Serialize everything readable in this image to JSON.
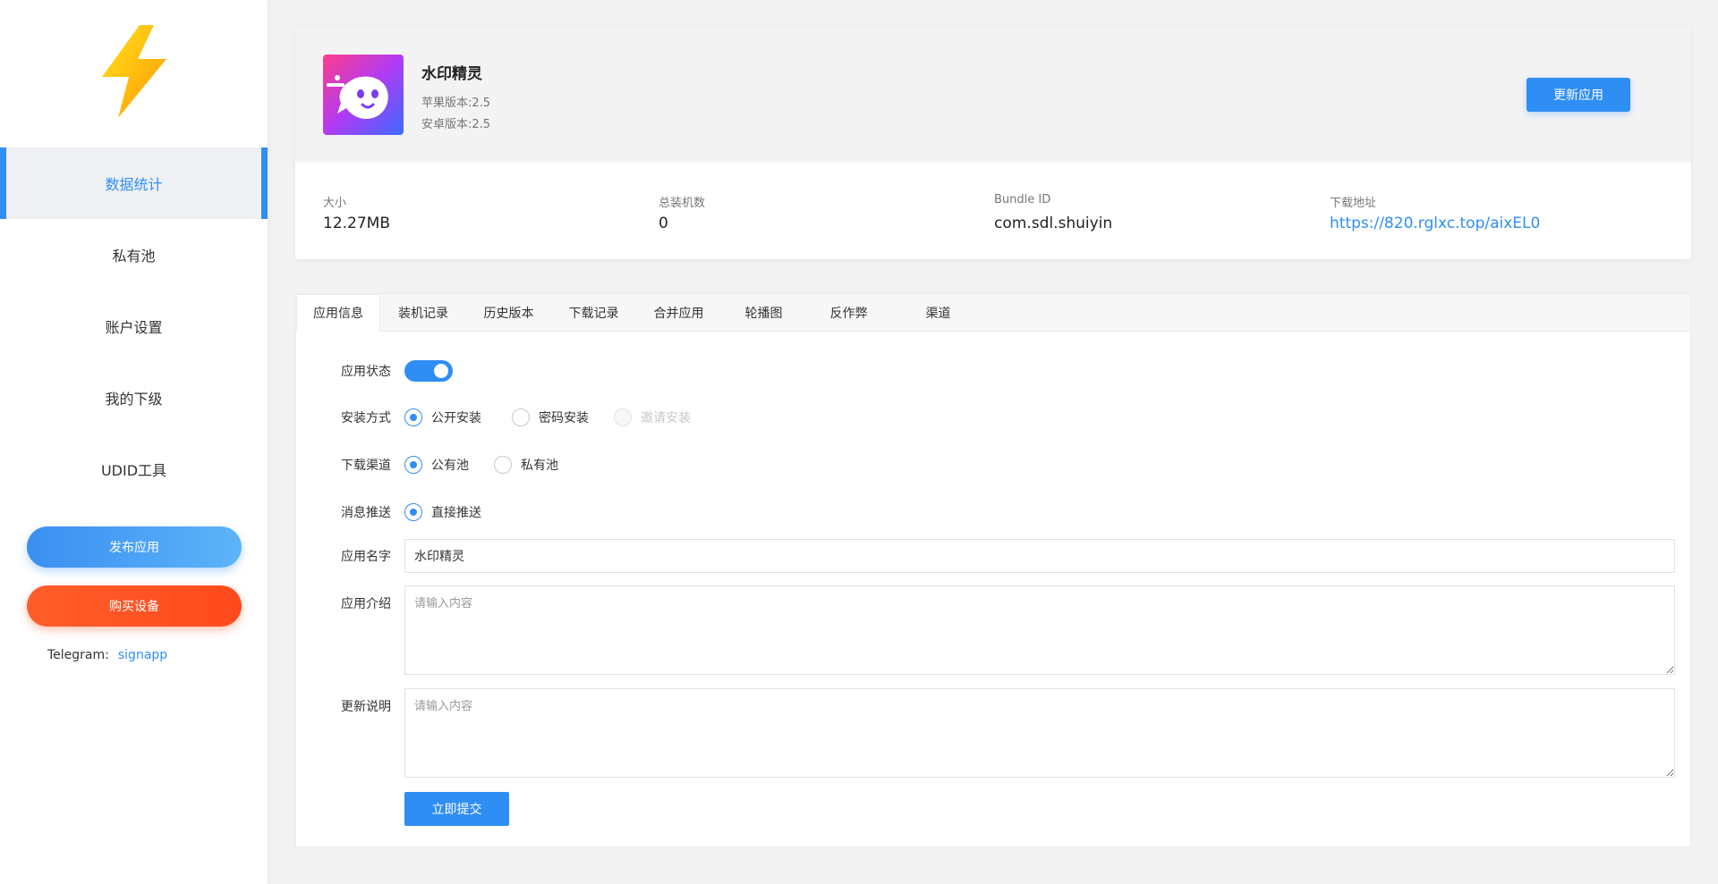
{
  "sidebar": {
    "nav": [
      {
        "label": "数据统计",
        "active": true
      },
      {
        "label": "私有池",
        "active": false
      },
      {
        "label": "账户设置",
        "active": false
      },
      {
        "label": "我的下级",
        "active": false
      },
      {
        "label": "UDID工具",
        "active": false
      }
    ],
    "publish_label": "发布应用",
    "buy_label": "购买设备",
    "telegram_label": "Telegram:",
    "telegram_value": "signapp",
    "logo_icon": "lightning-bolt-icon",
    "colors": {
      "accent": "#2f8ef4",
      "buy": "#ff5224",
      "logo_start": "#ffd21a",
      "logo_end": "#ff9f00"
    }
  },
  "app": {
    "icon": "app-logo-icon",
    "name": "水印精灵",
    "ios_version": "苹果版本:2.5",
    "android_version": "安卓版本:2.5",
    "update_label": "更新应用",
    "stats": [
      {
        "label": "大小",
        "value": "12.27MB",
        "link": false
      },
      {
        "label": "总装机数",
        "value": "0",
        "link": false
      },
      {
        "label": "Bundle ID",
        "value": "com.sdl.shuiyin",
        "link": false
      },
      {
        "label": "下载地址",
        "value": "https://820.rglxc.top/aixEL0",
        "link": true
      }
    ]
  },
  "tabs": [
    {
      "label": "应用信息",
      "active": true
    },
    {
      "label": "装机记录",
      "active": false
    },
    {
      "label": "历史版本",
      "active": false
    },
    {
      "label": "下载记录",
      "active": false
    },
    {
      "label": "合并应用",
      "active": false
    },
    {
      "label": "轮播图",
      "active": false
    },
    {
      "label": "反作弊",
      "active": false
    },
    {
      "label": "渠道",
      "active": false
    }
  ],
  "form": {
    "status": {
      "label": "应用状态",
      "on": true
    },
    "install": {
      "label": "安装方式",
      "options": [
        {
          "label": "公开安装",
          "checked": true,
          "disabled": false
        },
        {
          "label": "密码安装",
          "checked": false,
          "disabled": false
        },
        {
          "label": "邀请安装",
          "checked": false,
          "disabled": true
        }
      ]
    },
    "channel": {
      "label": "下载渠道",
      "options": [
        {
          "label": "公有池",
          "checked": true,
          "disabled": false
        },
        {
          "label": "私有池",
          "checked": false,
          "disabled": false
        }
      ]
    },
    "push": {
      "label": "消息推送",
      "options": [
        {
          "label": "直接推送",
          "checked": true,
          "disabled": false
        }
      ]
    },
    "name": {
      "label": "应用名字",
      "value": "水印精灵"
    },
    "intro": {
      "label": "应用介绍",
      "placeholder": "请输入内容"
    },
    "changelog": {
      "label": "更新说明",
      "placeholder": "请输入内容"
    },
    "submit_label": "立即提交"
  }
}
